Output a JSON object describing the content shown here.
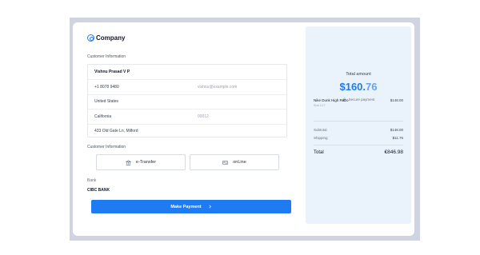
{
  "brand": {
    "name": "Company",
    "icon": "at-sign-icon"
  },
  "customer_section": {
    "label": "Customer Information",
    "name": "Vishnu Prasad V P",
    "phone": "+1 8078 9480",
    "email": "vishnu@example.com",
    "country": "United States",
    "state": "California",
    "zip": "00012",
    "address": "433 Old Gate Ln, Milford"
  },
  "payment_section": {
    "label": "Customer Information",
    "options": [
      {
        "label": "e-Transfer",
        "icon": "bank-icon"
      },
      {
        "label": "onLine",
        "icon": "id-card-icon"
      }
    ]
  },
  "bank": {
    "label": "Bank",
    "value": "CIBC BANK"
  },
  "pay_button": {
    "label": "Make Payment",
    "icon": "chevron-right-icon"
  },
  "summary": {
    "total_label": "Total amount",
    "amount_main": "$160.",
    "amount_decimal": "76",
    "secure_text": "Secure payment",
    "item": {
      "name": "Nike Dunk High Retro",
      "size": "Size 12.7",
      "price": "$148.00"
    },
    "subtotal_label": "Subtotal",
    "subtotal_value": "$148.00",
    "shipping_label": "Shipping",
    "shipping_value": "$11.76",
    "total_label_row": "Total",
    "total_value": "€846.98"
  },
  "colors": {
    "accent": "#1e7bf2",
    "panel": "#eaf2fc",
    "frame": "#cfd4e0"
  }
}
